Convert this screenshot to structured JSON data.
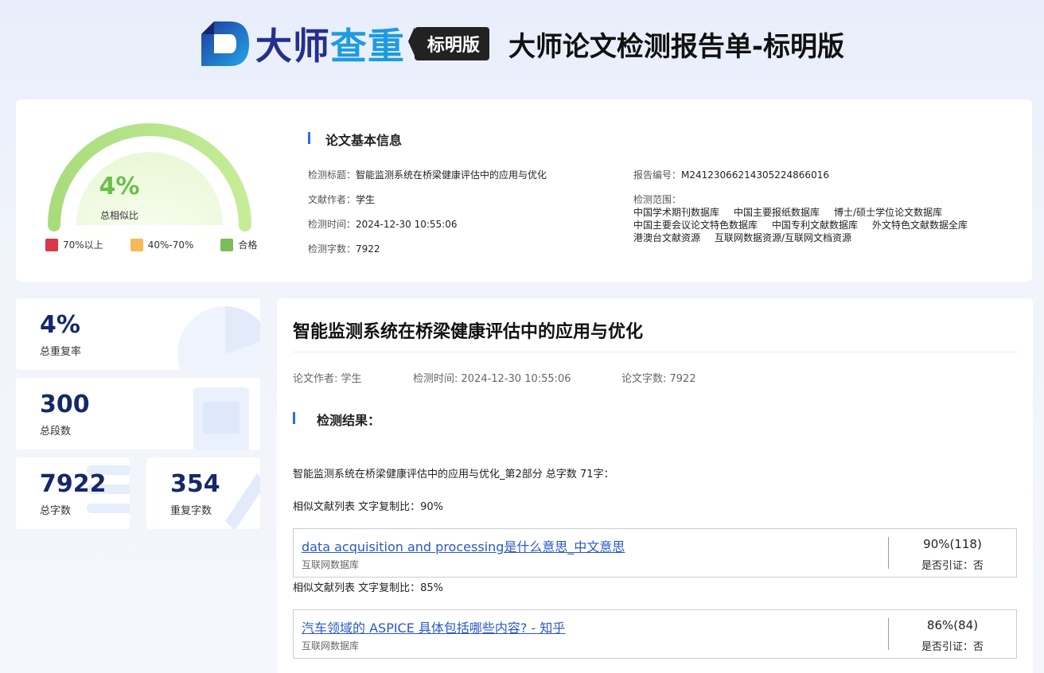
{
  "header": {
    "logo_part1": "大师",
    "logo_part2": "查重",
    "badge": "标明版",
    "report_title": "大师论文检测报告单-标明版"
  },
  "gauge": {
    "value": "4%",
    "fraction": 0.04,
    "label": "总相似比"
  },
  "legend": [
    {
      "label": "70%以上",
      "color": "#d9384a"
    },
    {
      "label": "40%-70%",
      "color": "#f7b955"
    },
    {
      "label": "合格",
      "color": "#7bbd5a"
    }
  ],
  "basic_info": {
    "title": "论文基本信息",
    "check_title_label": "检测标题：",
    "check_title_value": "智能监测系统在桥梁健康评估中的应用与优化",
    "author_label": "文献作者：",
    "author_value": "学生",
    "time_label": "检测时间：",
    "time_value": "2024-12-30 10:55:06",
    "words_label": "检测字数：",
    "words_value": "7922",
    "report_no_label": "报告编号：",
    "report_no_value": "M2412306621430522486601​6",
    "scope_label": "检测范围：",
    "scope_rows": [
      [
        "中国学术期刊数据库",
        "中国主要报纸数据库",
        "博士/硕士学位论文数据库"
      ],
      [
        "中国主要会议论文特色数据库",
        "中国专利文献数据库",
        "外文特色文献数据全库"
      ],
      [
        "港澳台文献资源",
        "互联网数据资源/互联网文档资源"
      ]
    ]
  },
  "stats": {
    "total_rate": {
      "num": "4%",
      "label": "总重复率"
    },
    "total_segments": {
      "num": "300",
      "label": "总段数"
    },
    "total_words": {
      "num": "7922",
      "label": "总字数"
    },
    "repeat_words": {
      "num": "354",
      "label": "重复字数"
    }
  },
  "report": {
    "paper_title": "智能监测系统在桥梁健康评估中的应用与优化",
    "author": "论文作者: 学生",
    "check_time": "检测时间: 2024-12-30 10:55:06",
    "word_count": "论文字数: 7922",
    "result_title": "检测结果：",
    "segment_title": "智能监测系统在桥梁健康评估中的应用与优化_第2部分 总字数 71字：",
    "items": [
      {
        "sim_label": "相似文献列表 文字复制比：90%",
        "link": "data acquisition and processing是什么意思_中文意思",
        "db": "互联网数据库",
        "pct": "90%(118)",
        "cite": "是否引证：否"
      },
      {
        "sim_label": "相似文献列表 文字复制比：85%",
        "link": "汽车领域的 ASPICE 具体包括哪些内容? - 知乎",
        "db": "互联网数据库",
        "pct": "86%(84)",
        "cite": "是否引证：否"
      }
    ]
  }
}
